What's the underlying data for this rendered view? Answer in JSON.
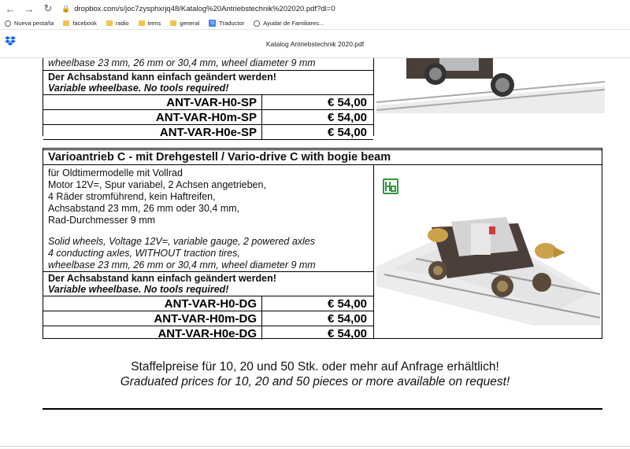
{
  "browser": {
    "back": "←",
    "forward": "→",
    "reload": "↻",
    "url": "dropbox.com/s/joc7zysphxrjq48/Katalog%20Antriebstechnik%202020.pdf?dl=0"
  },
  "bookmarks": [
    {
      "label": "Nueva pestaña",
      "icon": "globe-icon"
    },
    {
      "label": "facebook",
      "icon": "folder-icon"
    },
    {
      "label": "radio",
      "icon": "folder-icon"
    },
    {
      "label": "trens",
      "icon": "folder-icon"
    },
    {
      "label": "general",
      "icon": "folder-icon"
    },
    {
      "label": "Traductor",
      "icon": "translate-icon"
    },
    {
      "label": "Ayudar de Familiares...",
      "icon": "globe-icon"
    }
  ],
  "viewer": {
    "title": "Katalog Antriebstechnik 2020.pdf"
  },
  "product_top": {
    "spec_en_tail": "wheelbase 23 mm, 26 mm or 30,4 mm, wheel diameter 9 mm",
    "note_de": "Der Achsabstand kann einfach geändert werden!",
    "note_en": "Variable wheelbase. No tools required!",
    "rows": [
      {
        "code": "ANT-VAR-H0-SP",
        "price": "€ 54,00"
      },
      {
        "code": "ANT-VAR-H0m-SP",
        "price": "€ 54,00"
      },
      {
        "code": "ANT-VAR-H0e-SP",
        "price": "€ 54,00"
      }
    ]
  },
  "product_c": {
    "heading": "Varioantrieb C - mit Drehgestell / Vario-drive C with bogie beam",
    "desc_de": [
      "für Oldtimermodelle mit Vollrad",
      "Motor 12V=, Spur variabel, 2 Achsen angetrieben,",
      "4 Räder stromführend, kein Haftreifen,",
      "Achsabstand 23 mm, 26 mm oder 30,4 mm,",
      "Rad-Durchmesser 9 mm"
    ],
    "desc_en": [
      "Solid wheels, Voltage 12V=, variable gauge, 2 powered axles",
      "4 conducting axles, WITHOUT traction tires,",
      "wheelbase 23 mm, 26 mm or 30,4 mm, wheel diameter 9 mm"
    ],
    "note_de": "Der Achsabstand kann einfach geändert werden!",
    "note_en": "Variable wheelbase. No tools required!",
    "rows": [
      {
        "code": "ANT-VAR-H0-DG",
        "price": "€ 54,00"
      },
      {
        "code": "ANT-VAR-H0m-DG",
        "price": "€ 54,00"
      },
      {
        "code": "ANT-VAR-H0e-DG",
        "price": "€ 54,00"
      }
    ],
    "badge_icon": "h0-scale-icon"
  },
  "footer": {
    "de": "Staffelpreise für 10, 20 und 50 Stk. oder mehr auf Anfrage erhältlich!",
    "en": "Graduated prices for 10, 20 and 50 pieces or more available on request!"
  },
  "colors": {
    "dropbox_blue": "#0061fe",
    "badge_green": "#2e9a3e",
    "brass": "#c9a24a"
  }
}
